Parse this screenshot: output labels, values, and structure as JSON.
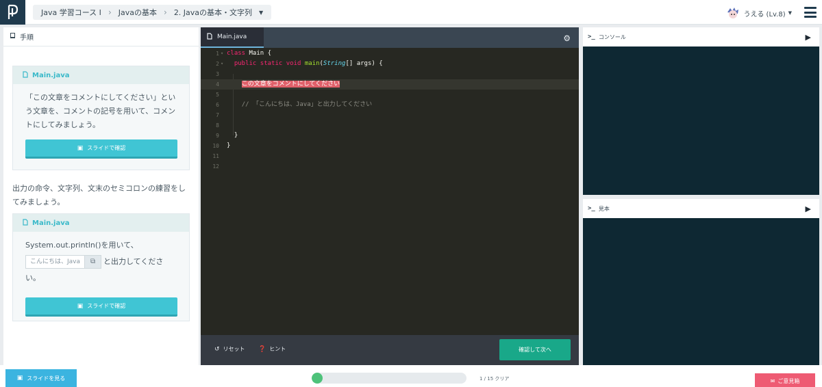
{
  "header": {
    "breadcrumbs": [
      "Java 学習コース I",
      "Javaの基本",
      "2. Javaの基本・文字列"
    ],
    "user_label": "うえる (Lv.8)",
    "logo_icon": "progate-logo-icon",
    "menu_icon": "hamburger-icon"
  },
  "instructions": {
    "title": "手順",
    "card1": {
      "file": "Main.java",
      "text": "「この文章をコメントにしてください」という文章を、コメントの記号を用いて、コメントにしてみましょう。",
      "button": "スライドで確認"
    },
    "paragraph": "出力の命令、文字列、文末のセミコロンの練習をしてみましょう。",
    "card2": {
      "file": "Main.java",
      "text_before": "System.out.println()を用いて、",
      "copy_code": "こんにちは、Java",
      "text_after": "と出力してください。",
      "button": "スライドで確認"
    }
  },
  "editor": {
    "tab": "Main.java",
    "lines": [
      {
        "n": "1",
        "fold": true,
        "parts": [
          {
            "c": "kw",
            "t": "class"
          },
          {
            "c": "",
            "t": " Main {"
          }
        ]
      },
      {
        "n": "2",
        "fold": true,
        "parts": [
          {
            "c": "",
            "t": "  "
          },
          {
            "c": "kw",
            "t": "public static void"
          },
          {
            "c": "",
            "t": " "
          },
          {
            "c": "fn",
            "t": "main"
          },
          {
            "c": "",
            "t": "("
          },
          {
            "c": "ty",
            "t": "String"
          },
          {
            "c": "",
            "t": "[] args) {"
          }
        ]
      },
      {
        "n": "3",
        "parts": []
      },
      {
        "n": "4",
        "active": true,
        "parts": [
          {
            "c": "",
            "t": "    "
          },
          {
            "c": "hl",
            "t": "この文章をコメントにしてください"
          }
        ]
      },
      {
        "n": "5",
        "parts": []
      },
      {
        "n": "6",
        "parts": [
          {
            "c": "",
            "t": "    "
          },
          {
            "c": "cm",
            "t": "// 「こんにちは、Java」と出力してください"
          }
        ]
      },
      {
        "n": "7",
        "parts": []
      },
      {
        "n": "8",
        "parts": []
      },
      {
        "n": "9",
        "parts": [
          {
            "c": "",
            "t": "  }"
          }
        ]
      },
      {
        "n": "10",
        "parts": [
          {
            "c": "",
            "t": "}"
          }
        ]
      },
      {
        "n": "11",
        "parts": []
      },
      {
        "n": "12",
        "parts": []
      }
    ],
    "reset_label": "リセット",
    "hint_label": "ヒント",
    "submit_label": "確認して次へ"
  },
  "console": {
    "title": "コンソール",
    "prompt": ">_"
  },
  "sample": {
    "title": "見本",
    "prompt": ">_"
  },
  "footer": {
    "see_slide": "スライドを見る",
    "progress_label": "1 / 15 クリア",
    "progress_fraction": 0.067,
    "opinion": "ご意見箱"
  },
  "colors": {
    "accent": "#40c5d4",
    "submit": "#19a889",
    "highlight": "#e0606a",
    "opinion": "#ee5b73"
  }
}
